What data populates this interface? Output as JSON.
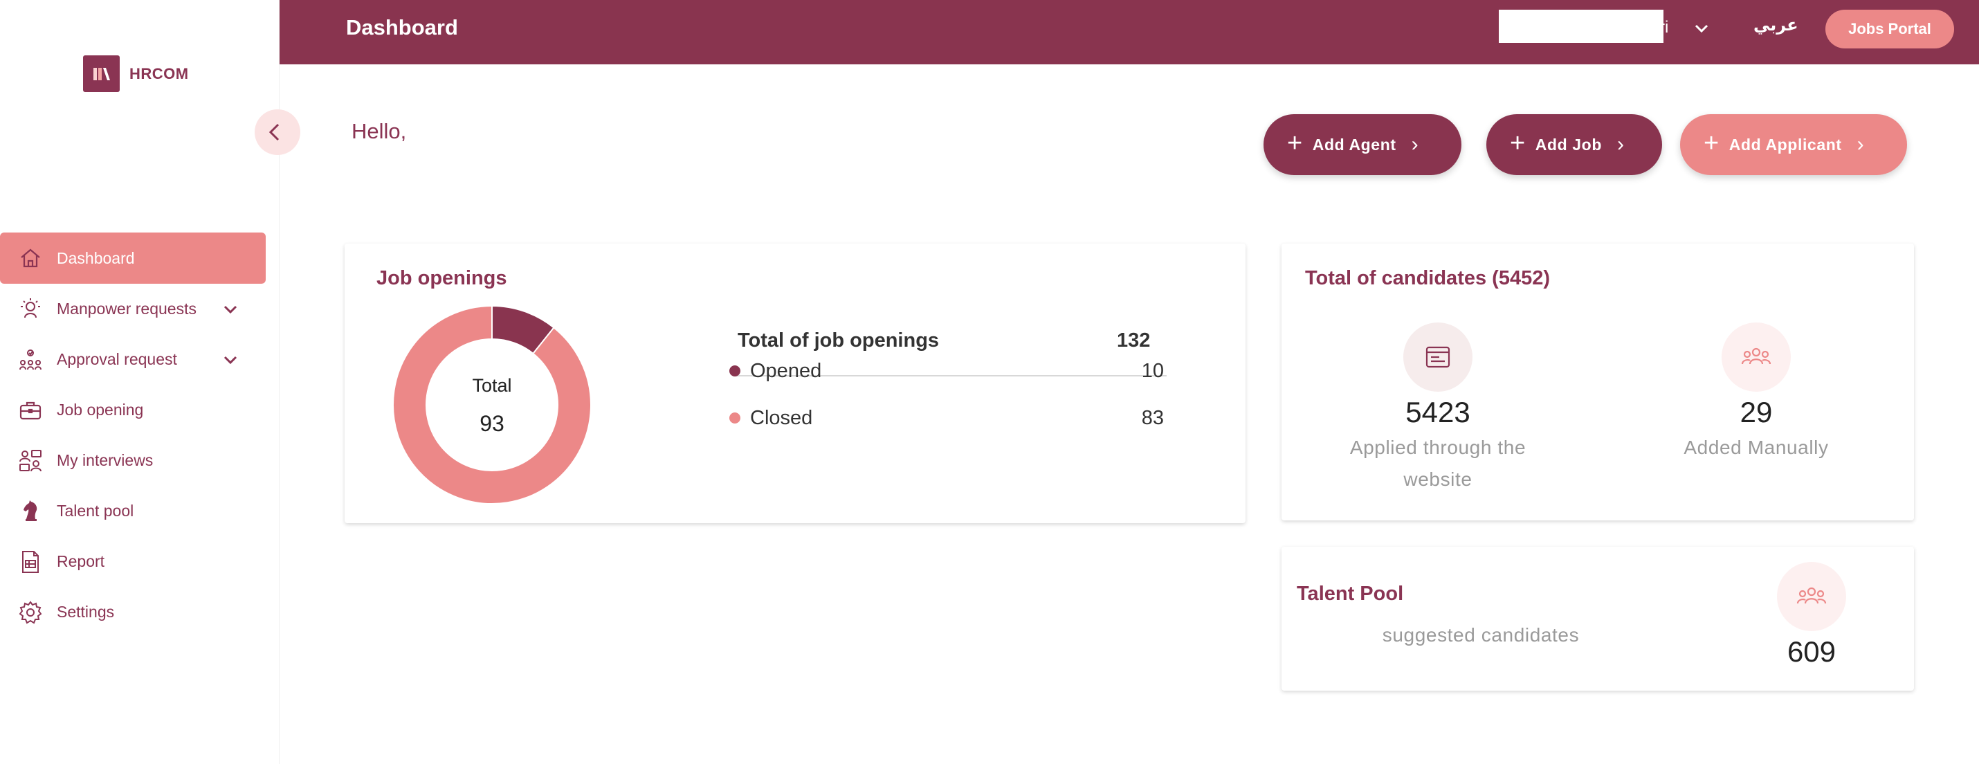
{
  "brand": {
    "name": "HRCOM",
    "color": "#8a3453",
    "accent": "#ec8888"
  },
  "sidebar": {
    "items": [
      {
        "label": "Dashboard",
        "icon": "home-icon",
        "active": true
      },
      {
        "label": "Manpower requests",
        "icon": "manpower-icon",
        "expandable": true
      },
      {
        "label": "Approval request",
        "icon": "approval-icon",
        "expandable": true
      },
      {
        "label": "Job opening",
        "icon": "briefcase-icon"
      },
      {
        "label": "My interviews",
        "icon": "interviews-icon"
      },
      {
        "label": "Talent pool",
        "icon": "chess-knight-icon"
      },
      {
        "label": "Report",
        "icon": "report-icon"
      },
      {
        "label": "Settings",
        "icon": "gear-icon"
      }
    ]
  },
  "header": {
    "title": "Dashboard",
    "user_name_fragment": "ri",
    "language_label": "عربي",
    "jobs_portal_label": "Jobs Portal"
  },
  "main": {
    "greeting": "Hello,",
    "actions": {
      "add_agent": "Add Agent",
      "add_job": "Add Job",
      "add_applicant": "Add Applicant"
    },
    "job_openings": {
      "title": "Job openings",
      "total_label": "Total",
      "total_value": "93",
      "summary_label": "Total of job openings",
      "summary_value": "132",
      "rows": [
        {
          "label": "Opened",
          "value": "10",
          "color": "#89344f"
        },
        {
          "label": "Closed",
          "value": "83",
          "color": "#ec8888"
        }
      ]
    },
    "candidates": {
      "title": "Total of candidates (5452)",
      "website": {
        "value": "5423",
        "label_line1": "Applied through the",
        "label_line2": "website"
      },
      "manual": {
        "value": "29",
        "label": "Added Manually"
      }
    },
    "talent_pool": {
      "title": "Talent Pool",
      "label": "suggested candidates",
      "value": "609"
    }
  }
}
